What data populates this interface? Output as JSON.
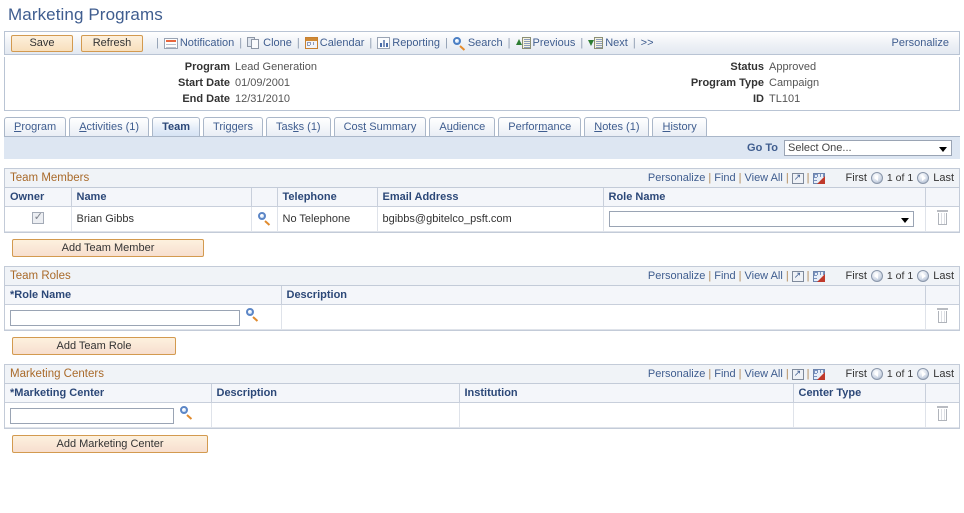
{
  "page_title": "Marketing Programs",
  "colors": {
    "title_blue": "#3f5d8f",
    "section_title_brown": "#a96a2a",
    "header_blue": "#2c4878",
    "button_border_orange": "#d39a4f",
    "goto_bar_bg": "#dde6f2"
  },
  "toolbar": {
    "save_label": "Save",
    "refresh_label": "Refresh",
    "notification_label": "Notification",
    "clone_label": "Clone",
    "calendar_label": "Calendar",
    "reporting_label": "Reporting",
    "search_label": "Search",
    "previous_label": "Previous",
    "next_label": "Next",
    "more_label": ">>",
    "personalize_label": "Personalize",
    "separator": "|",
    "icons": {
      "notification": "envelope-icon",
      "clone": "copy-pages-icon",
      "calendar": "calendar-icon",
      "reporting": "bar-chart-icon",
      "search": "magnifier-icon",
      "previous": "document-up-arrow-icon",
      "next": "document-down-arrow-icon"
    }
  },
  "header": {
    "left": [
      {
        "label": "Program",
        "value": "Lead Generation"
      },
      {
        "label": "Start Date",
        "value": "01/09/2001"
      },
      {
        "label": "End Date",
        "value": "12/31/2010"
      }
    ],
    "right": [
      {
        "label": "Status",
        "value": "Approved"
      },
      {
        "label": "Program Type",
        "value": "Campaign"
      },
      {
        "label": "ID",
        "value": "TL101"
      }
    ]
  },
  "tabs": [
    {
      "label": "Program",
      "accel": "P",
      "active": false
    },
    {
      "label": "Activities (1)",
      "accel": "A",
      "active": false
    },
    {
      "label": "Team",
      "accel": "",
      "active": true
    },
    {
      "label": "Triggers",
      "accel": "g",
      "active": false
    },
    {
      "label": "Tasks (1)",
      "accel": "k",
      "active": false
    },
    {
      "label": "Cost Summary",
      "accel": "t",
      "active": false
    },
    {
      "label": "Audience",
      "accel": "u",
      "active": false
    },
    {
      "label": "Performance",
      "accel": "m",
      "active": false
    },
    {
      "label": "Notes (1)",
      "accel": "N",
      "active": false
    },
    {
      "label": "History",
      "accel": "H",
      "active": false
    }
  ],
  "goto": {
    "label": "Go To",
    "selected": "Select One...",
    "options": [
      "Select One..."
    ]
  },
  "grid_controls": {
    "personalize": "Personalize",
    "find": "Find",
    "view_all": "View All",
    "expand_icon": "expand-icon",
    "download_icon": "download-to-spreadsheet-icon",
    "first": "First",
    "last": "Last",
    "count": "1 of 1",
    "prev_icon": "prev-page-icon",
    "next_icon": "next-page-icon"
  },
  "team_members": {
    "title": "Team Members",
    "columns": [
      "Owner",
      "Name",
      "",
      "Telephone",
      "Email Address",
      "Role Name",
      ""
    ],
    "rows": [
      {
        "owner_checked": true,
        "name": "Brian Gibbs",
        "lookup_icon": "magnifier-icon",
        "telephone": "No Telephone",
        "email": "bgibbs@gbitelco_psft.com",
        "role_name": "",
        "delete_icon": "trash-icon"
      }
    ],
    "add_button": "Add Team Member"
  },
  "team_roles": {
    "title": "Team Roles",
    "columns": [
      "*Role Name",
      "Description",
      ""
    ],
    "rows": [
      {
        "role_name": "",
        "lookup_icon": "magnifier-icon",
        "description": "",
        "delete_icon": "trash-icon"
      }
    ],
    "add_button": "Add Team Role"
  },
  "marketing_centers": {
    "title": "Marketing Centers",
    "columns": [
      "*Marketing Center",
      "Description",
      "Institution",
      "Center Type",
      ""
    ],
    "rows": [
      {
        "marketing_center": "",
        "lookup_icon": "magnifier-icon",
        "description": "",
        "institution": "",
        "center_type": "",
        "delete_icon": "trash-icon"
      }
    ],
    "add_button": "Add Marketing Center"
  }
}
